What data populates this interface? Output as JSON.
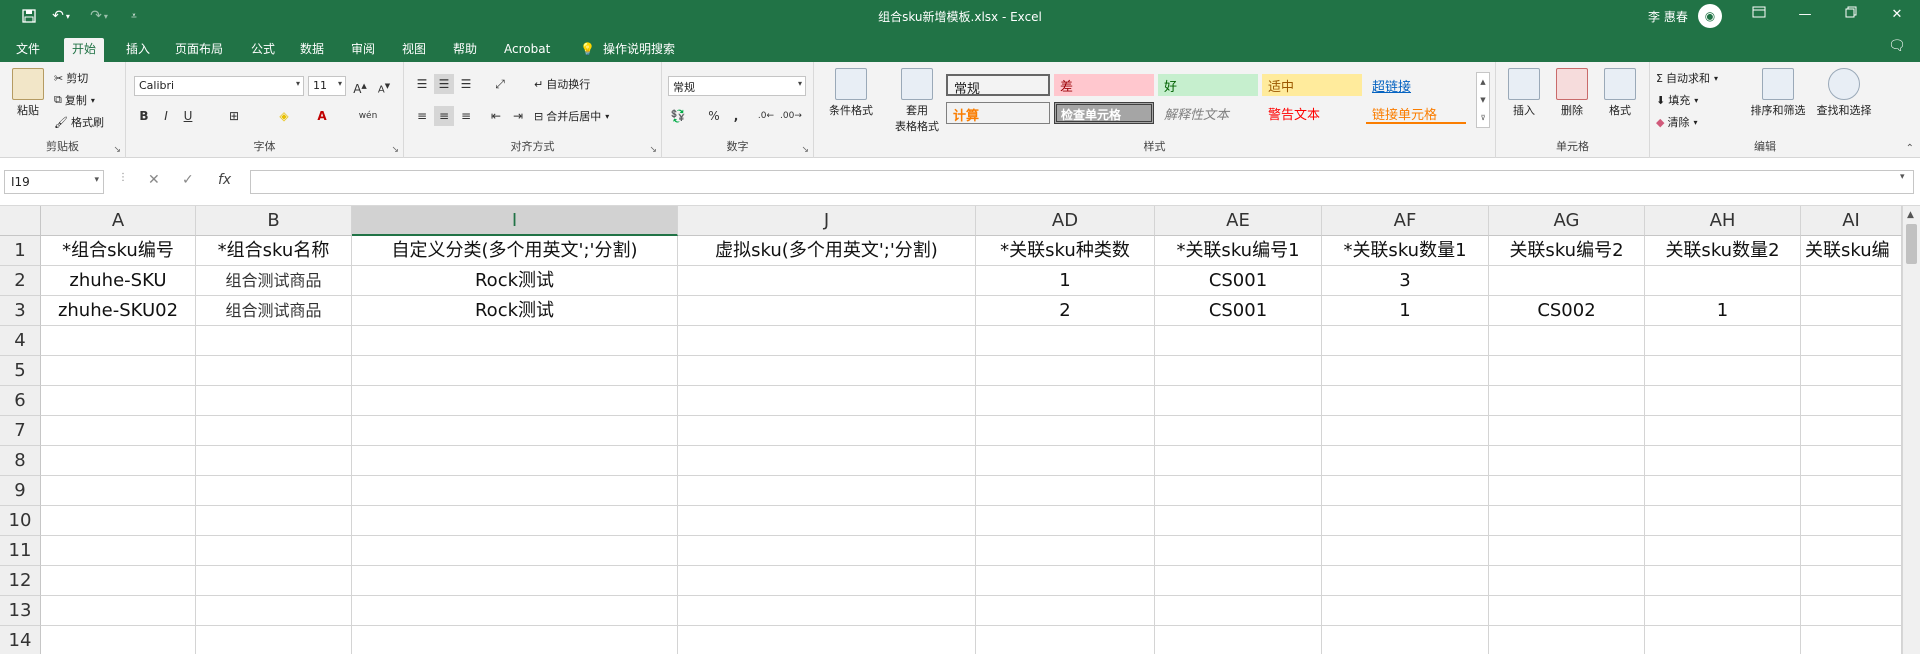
{
  "titlebar": {
    "title": "组合sku新增模板.xlsx  -  Excel",
    "user": "李 惠春",
    "avatar_text": "◉",
    "save_icon": "save-icon",
    "undo_icon": "undo-icon",
    "redo_icon": "redo-icon",
    "customize_icon": "customize-icon",
    "ribbon_display_icon": "ribbon-display-icon",
    "minimize_icon": "minimize-icon",
    "restore_icon": "restore-icon",
    "close_icon": "close-icon"
  },
  "tabs": [
    "文件",
    "开始",
    "插入",
    "页面布局",
    "公式",
    "数据",
    "审阅",
    "视图",
    "帮助",
    "Acrobat"
  ],
  "active_tab": "开始",
  "tell_me": "操作说明搜索",
  "ribbon": {
    "clipboard": {
      "label": "剪贴板",
      "paste": "粘贴",
      "cut": "剪切",
      "copy": "复制",
      "format_painter": "格式刷"
    },
    "font": {
      "label": "字体",
      "name": "Calibri",
      "size": "11",
      "bold": "B",
      "italic": "I",
      "underline": "U",
      "grow": "A",
      "shrink": "A"
    },
    "alignment": {
      "label": "对齐方式",
      "wrap": "自动换行",
      "merge": "合并后居中"
    },
    "number": {
      "label": "数字",
      "format": "常规",
      "percent": "%",
      "comma": ","
    },
    "styles": {
      "label": "样式",
      "conditional": "条件格式",
      "table_format_1": "套用",
      "table_format_2": "表格格式",
      "cells": [
        {
          "text": "常规",
          "bg": "#ffffff",
          "color": "#000000"
        },
        {
          "text": "差",
          "bg": "#ffc7ce",
          "color": "#9c0006"
        },
        {
          "text": "好",
          "bg": "#c6efce",
          "color": "#006100"
        },
        {
          "text": "适中",
          "bg": "#ffeb9c",
          "color": "#9c5700"
        },
        {
          "text": "超链接",
          "bg": "#ffffff",
          "color": "#0563c1"
        },
        {
          "text": "计算",
          "bg": "#f2f2f2",
          "color": "#fa7d00"
        },
        {
          "text": "检查单元格",
          "bg": "#a5a5a5",
          "color": "#ffffff"
        },
        {
          "text": "解释性文本",
          "bg": "#ffffff",
          "color": "#7f7f7f"
        },
        {
          "text": "警告文本",
          "bg": "#ffffff",
          "color": "#ff0000"
        },
        {
          "text": "链接单元格",
          "bg": "#ffffff",
          "color": "#fa7d00"
        }
      ]
    },
    "cells": {
      "label": "单元格",
      "insert": "插入",
      "delete": "删除",
      "format": "格式"
    },
    "editing": {
      "label": "编辑",
      "autosum": "自动求和",
      "fill": "填充",
      "clear": "清除",
      "sort": "排序和筛选",
      "find": "查找和选择"
    }
  },
  "formula_bar": {
    "name_box": "I19",
    "fx": "fx",
    "value": ""
  },
  "sheet": {
    "columns": [
      {
        "letter": "A"
      },
      {
        "letter": "B"
      },
      {
        "letter": "I",
        "selected": true
      },
      {
        "letter": "J"
      },
      {
        "letter": "AD"
      },
      {
        "letter": "AE"
      },
      {
        "letter": "AF"
      },
      {
        "letter": "AG"
      },
      {
        "letter": "AH"
      },
      {
        "letter": "AI"
      }
    ],
    "row_numbers": [
      "1",
      "2",
      "3",
      "4",
      "5",
      "6",
      "7",
      "8",
      "9",
      "10",
      "11",
      "12",
      "13",
      "14"
    ],
    "rows": [
      [
        "*组合sku编号",
        "*组合sku名称",
        "自定义分类(多个用英文';'分割)",
        "虚拟sku(多个用英文';'分割)",
        "*关联sku种类数",
        "*关联sku编号1",
        "*关联sku数量1",
        "关联sku编号2",
        "关联sku数量2",
        "关联sku编"
      ],
      [
        "zhuhe-SKU",
        "组合测试商品",
        "Rock测试",
        "",
        "1",
        "CS001",
        "3",
        "",
        "",
        ""
      ],
      [
        "zhuhe-SKU02",
        "组合测试商品",
        "Rock测试",
        "",
        "2",
        "CS001",
        "1",
        "CS002",
        "1",
        ""
      ]
    ]
  }
}
